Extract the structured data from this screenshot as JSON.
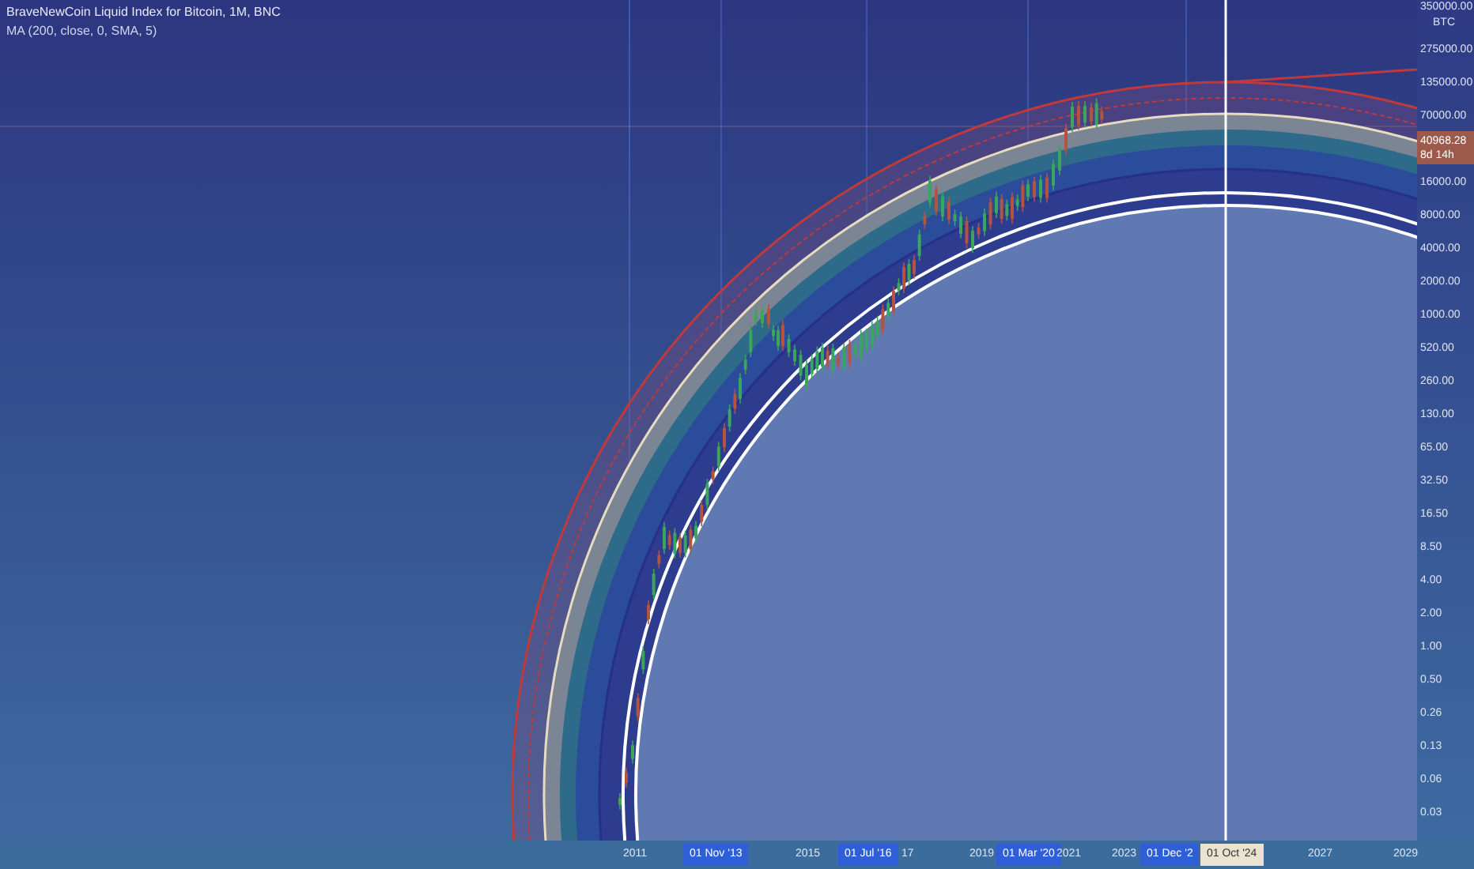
{
  "legend": {
    "title": "BraveNewCoin Liquid Index for Bitcoin, 1M, BNC",
    "indicator": "MA (200, close, 0, SMA, 5)"
  },
  "price_axis": {
    "top_tick": "350000.00",
    "unit": "BTC",
    "ticks": [
      "275000.00",
      "135000.00",
      "70000.00",
      "16000.00",
      "8000.00",
      "4000.00",
      "2000.00",
      "1000.00",
      "520.00",
      "260.00",
      "130.00",
      "65.00",
      "32.50",
      "16.50",
      "8.50",
      "4.00",
      "2.00",
      "1.00",
      "0.50",
      "0.26",
      "0.13",
      "0.06",
      "0.03"
    ]
  },
  "last_price": {
    "price": "40968.28",
    "countdown": "8d 14h"
  },
  "time_axis": {
    "labels": [
      {
        "text": "2011",
        "kind": "year"
      },
      {
        "text": "01 Nov '13",
        "kind": "marker"
      },
      {
        "text": "2015",
        "kind": "year"
      },
      {
        "text": "01 Jul '16",
        "kind": "marker"
      },
      {
        "text": "17",
        "kind": "year"
      },
      {
        "text": "2019",
        "kind": "year"
      },
      {
        "text": "01 Mar '20",
        "kind": "marker"
      },
      {
        "text": "2021",
        "kind": "year"
      },
      {
        "text": "2023",
        "kind": "year"
      },
      {
        "text": "01 Dec '2",
        "kind": "marker"
      },
      {
        "text": "01 Oct '24",
        "kind": "cursor"
      },
      {
        "text": "2027",
        "kind": "year"
      },
      {
        "text": "2029",
        "kind": "year"
      }
    ]
  }
}
